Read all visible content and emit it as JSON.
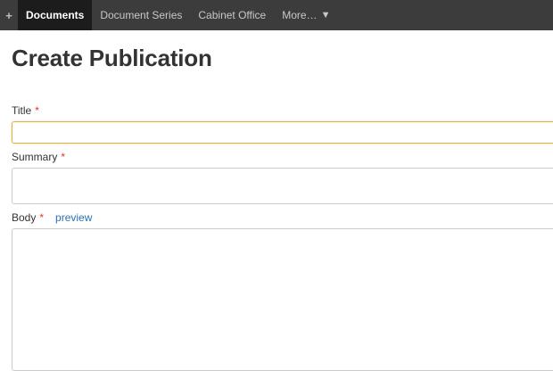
{
  "nav": {
    "add_symbol": "+",
    "items": [
      {
        "label": "Documents",
        "active": true
      },
      {
        "label": "Document Series",
        "active": false
      },
      {
        "label": "Cabinet Office",
        "active": false
      },
      {
        "label": "More…",
        "active": false
      }
    ],
    "more_caret": "▼"
  },
  "page": {
    "title": "Create Publication"
  },
  "form": {
    "required_marker": "*",
    "title_label": "Title",
    "title_value": "",
    "summary_label": "Summary",
    "summary_value": "",
    "body_label": "Body",
    "body_preview_link": "preview",
    "body_value": ""
  },
  "colors": {
    "navbar_bg": "#3c3c3c",
    "nav_active_bg": "#1c1c1c",
    "required": "#d93a2b",
    "link": "#2b6fb6",
    "focus_border": "#e3b341"
  }
}
